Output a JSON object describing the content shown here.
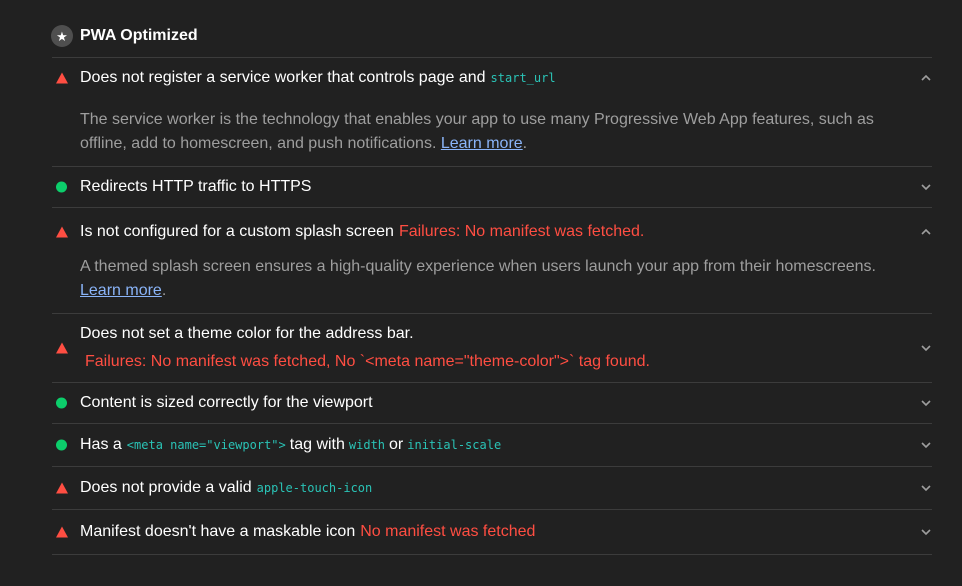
{
  "section": {
    "icon": "star-icon",
    "title": "PWA Optimized"
  },
  "colors": {
    "pass": "#0cce6b",
    "fail": "#ff4e42",
    "code": "#2ac3b6",
    "link": "#8ab4f8"
  },
  "audits": [
    {
      "status": "fail",
      "title": "Does not register a service worker that controls page and",
      "code": "start_url",
      "expanded": true,
      "description": "The service worker is the technology that enables your app to use many Progressive Web App features, such as offline, add to homescreen, and push notifications.",
      "link": "Learn more",
      "after_link": "."
    },
    {
      "status": "pass",
      "title": "Redirects HTTP traffic to HTTPS",
      "expanded": false
    },
    {
      "status": "fail",
      "title": "Is not configured for a custom splash screen",
      "failure": "Failures: No manifest was fetched.",
      "expanded": true,
      "description": "A themed splash screen ensures a high-quality experience when users launch your app from their homescreens.",
      "link": "Learn more",
      "after_link": "."
    },
    {
      "status": "fail",
      "title": "Does not set a theme color for the address bar.",
      "failure": "Failures: No manifest was fetched, No `<meta name=\"theme-color\">` tag found.",
      "expanded": false
    },
    {
      "status": "pass",
      "title": "Content is sized correctly for the viewport",
      "expanded": false
    },
    {
      "status": "pass",
      "title_prefix": "Has a",
      "code1": "<meta name=\"viewport\">",
      "title_mid": "tag with",
      "code2": "width",
      "title_or": "or",
      "code3": "initial-scale",
      "expanded": false
    },
    {
      "status": "fail",
      "title": "Does not provide a valid",
      "code": "apple-touch-icon",
      "expanded": false
    },
    {
      "status": "fail",
      "title": "Manifest doesn't have a maskable icon",
      "failure": "No manifest was fetched",
      "expanded": false
    }
  ]
}
